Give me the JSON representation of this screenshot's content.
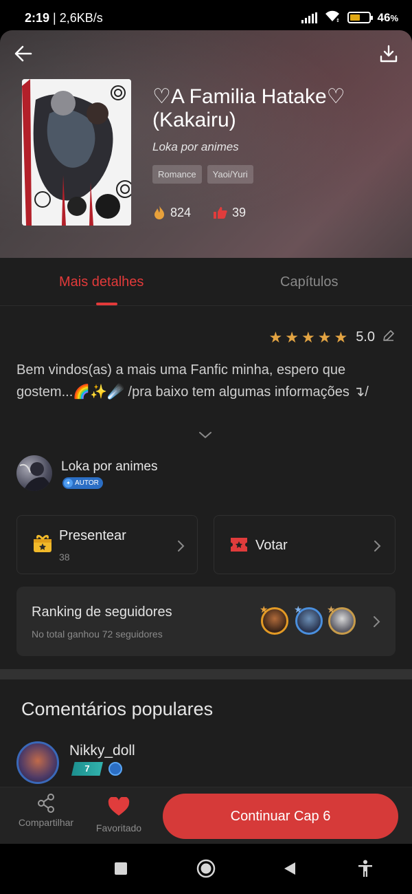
{
  "status_bar": {
    "time": "2:19",
    "speed": "| 2,6KB/s",
    "battery": "46",
    "battery_unit": "%"
  },
  "story": {
    "title": "♡A Familia Hatake♡ (Kakairu)",
    "author": "Loka por animes",
    "tags": [
      "Romance",
      "Yaoi/Yuri"
    ],
    "reads": "824",
    "likes": "39"
  },
  "tabs": {
    "details": "Mais detalhes",
    "chapters": "Capítulos"
  },
  "rating": {
    "value": "5.0",
    "stars": 5
  },
  "description": "Bem vindos(as) a mais uma Fanfic minha, espero que gostem...🌈✨☄️  /pra baixo tem algumas informações ↴/",
  "author_row": {
    "name": "Loka por animes",
    "badge": "AUTOR"
  },
  "gift_card": {
    "title": "Presentear",
    "count": "38"
  },
  "vote_card": {
    "title": "Votar"
  },
  "ranking": {
    "title": "Ranking de seguidores",
    "subtitle": "No total ganhou 72 seguidores"
  },
  "comments": {
    "title": "Comentários populares",
    "first_user": "Nikky_doll",
    "first_level": "7"
  },
  "bottom_bar": {
    "share_label": "Compartilhar",
    "favorite_label": "Favoritado",
    "continue_label": "Continuar Cap 6"
  },
  "colors": {
    "accent": "#e23a3a",
    "button": "#d63a39",
    "star": "#e3a443"
  }
}
